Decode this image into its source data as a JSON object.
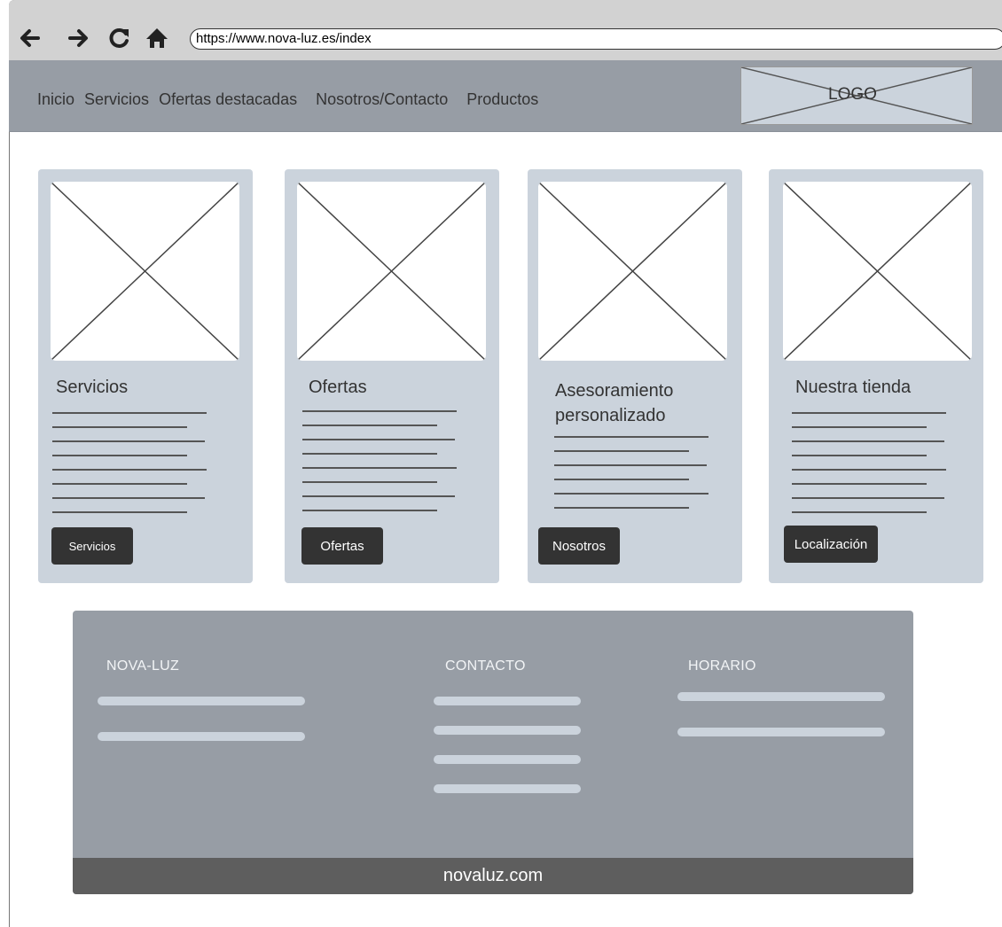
{
  "browser": {
    "url": "https://www.nova-luz.es/index",
    "icons": [
      "back-arrow-icon",
      "forward-arrow-icon",
      "reload-icon",
      "home-icon"
    ]
  },
  "header": {
    "nav": [
      "Inicio",
      "Servicios",
      "Ofertas destacadas",
      "Nosotros/Contacto",
      "Productos"
    ],
    "logo_text": "LOGO"
  },
  "cards": [
    {
      "title": "Servicios",
      "button": "Servicios"
    },
    {
      "title": "Ofertas",
      "button": "Ofertas"
    },
    {
      "title_line1": "Asesoramiento",
      "title_line2": "personalizado",
      "button": "Nosotros"
    },
    {
      "title": "Nuestra tienda",
      "button": "Localización"
    }
  ],
  "footer": {
    "col1": "NOVA-LUZ",
    "col2": "CONTACTO",
    "col3": "HORARIO",
    "bottom": "novaluz.com"
  },
  "colors": {
    "header_bg": "#979da5",
    "card_bg": "#cbd3dc",
    "button_bg": "#333333",
    "footer_bottom_bg": "#5e5e5e"
  }
}
